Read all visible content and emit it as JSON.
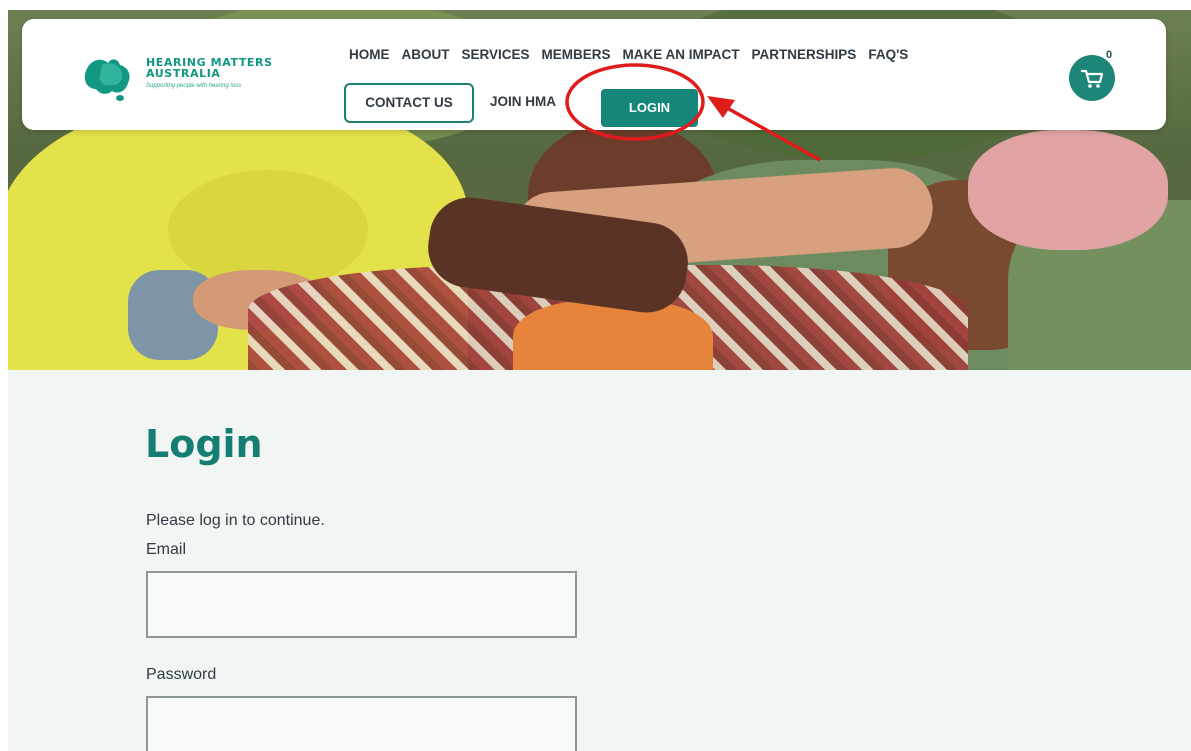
{
  "brand": {
    "name": "HEARING MATTERS AUSTRALIA",
    "tagline": "Supporting people with hearing loss",
    "colors": {
      "teal": "#17867a",
      "logo": "#129782",
      "annotation": "#e01b1b"
    }
  },
  "nav": {
    "items": [
      "HOME",
      "ABOUT",
      "SERVICES",
      "MEMBERS",
      "MAKE AN IMPACT",
      "PARTNERSHIPS",
      "FAQ'S"
    ],
    "contact_label": "CONTACT US",
    "join_label": "JOIN HMA",
    "login_label": "LOGIN",
    "cart_icon": "cart-icon",
    "cart_count": "0"
  },
  "annotation": {
    "shape": "circle-and-arrow",
    "target": "LOGIN"
  },
  "login": {
    "title": "Login",
    "message": "Please log in to continue.",
    "email_label": "Email",
    "email_value": "",
    "password_label": "Password",
    "password_value": ""
  }
}
